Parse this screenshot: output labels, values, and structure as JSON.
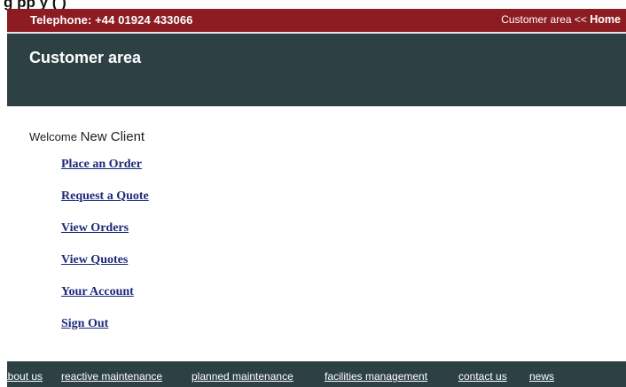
{
  "clipped_heading": "g                                    pp y          (                          )",
  "topbar": {
    "telephone": "Telephone: +44 01924 433066",
    "breadcrumb_current": "Customer area",
    "breadcrumb_sep": " << ",
    "breadcrumb_home": "Home"
  },
  "header": {
    "title": "Customer area"
  },
  "welcome": {
    "label": "Welcome",
    "name": "New Client"
  },
  "menu": {
    "items": [
      {
        "label": "Place an Order"
      },
      {
        "label": "Request a Quote"
      },
      {
        "label": "View Orders"
      },
      {
        "label": "View Quotes"
      },
      {
        "label": "Your Account"
      },
      {
        "label": "Sign Out"
      }
    ]
  },
  "footer": {
    "links": [
      {
        "label": "about us"
      },
      {
        "label": "reactive maintenance"
      },
      {
        "label": "planned maintenance"
      },
      {
        "label": "facilities management"
      },
      {
        "label": "contact us"
      },
      {
        "label": "news"
      }
    ]
  },
  "colors": {
    "topbar": "#8c1c22",
    "header": "#2d4144",
    "link": "#1b2a7a"
  }
}
